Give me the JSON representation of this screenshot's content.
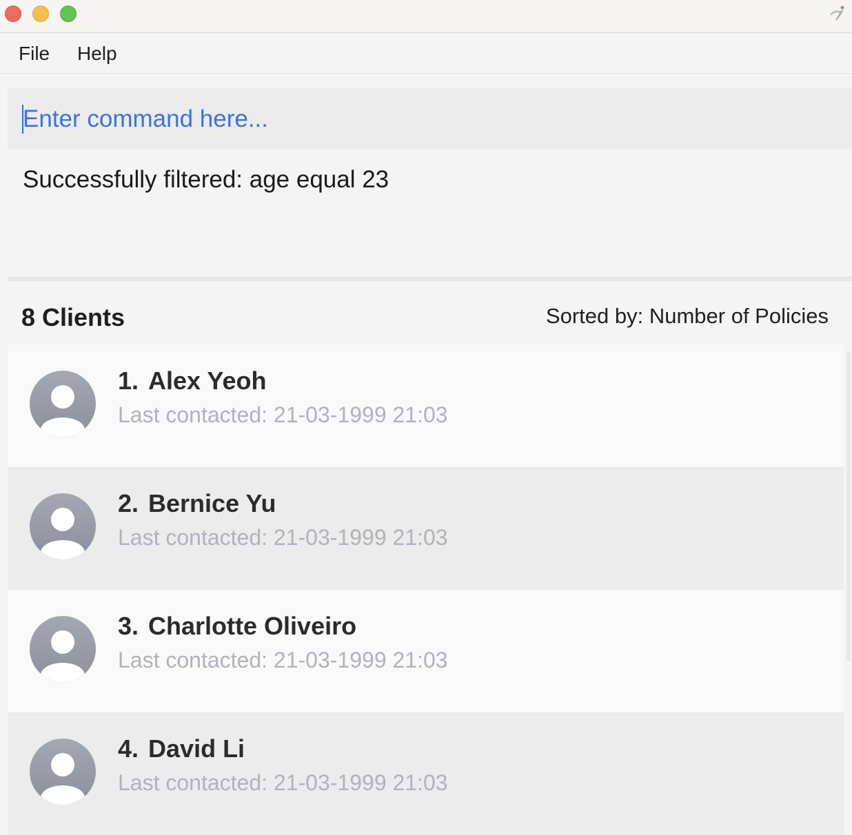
{
  "window": {
    "buttons": [
      "close",
      "minimize",
      "maximize"
    ],
    "app_icon": "app-logo-icon"
  },
  "menu": {
    "file_label": "File",
    "help_label": "Help"
  },
  "command": {
    "placeholder": "Enter command here...",
    "value": ""
  },
  "result": {
    "message": "Successfully filtered: age equal 23"
  },
  "list_header": {
    "count_label": "8 Clients",
    "sorted_label": "Sorted by: Number of Policies"
  },
  "clients": [
    {
      "index": "1.",
      "name": "Alex Yeoh",
      "last_contacted": "Last contacted: 21-03-1999 21:03"
    },
    {
      "index": "2.",
      "name": "Bernice Yu",
      "last_contacted": "Last contacted: 21-03-1999 21:03"
    },
    {
      "index": "3.",
      "name": "Charlotte Oliveiro",
      "last_contacted": "Last contacted: 21-03-1999 21:03"
    },
    {
      "index": "4.",
      "name": "David Li",
      "last_contacted": "Last contacted: 21-03-1999 21:03"
    }
  ],
  "colors": {
    "accent": "#2f6fe0",
    "avatar": "#9a9ea8",
    "muted_text": "#b3b1bc"
  }
}
